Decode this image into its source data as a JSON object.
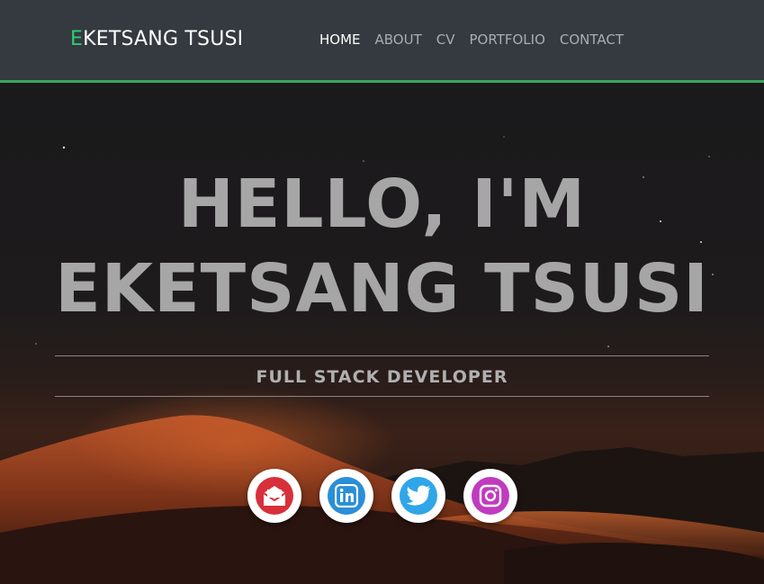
{
  "navbar": {
    "brand_first_letter": "E",
    "brand_rest": "KETSANG TSUSI",
    "links": [
      {
        "label": "HOME",
        "active": true
      },
      {
        "label": "ABOUT",
        "active": false
      },
      {
        "label": "CV",
        "active": false
      },
      {
        "label": "PORTFOLIO",
        "active": false
      },
      {
        "label": "CONTACT",
        "active": false
      }
    ]
  },
  "hero": {
    "headline_line1": "HELLO, I'M",
    "headline_line2": "EKETSANG TSUSI",
    "subtitle": "FULL STACK DEVELOPER"
  },
  "socials": [
    {
      "icon": "email-icon",
      "color": "#d8303a"
    },
    {
      "icon": "linkedin-icon",
      "color": "#2a8fd6"
    },
    {
      "icon": "twitter-icon",
      "color": "#2ea6e8"
    },
    {
      "icon": "instagram-icon",
      "color": "#c03bbf"
    }
  ],
  "colors": {
    "navbar_bg": "#343a40",
    "brand_accent": "#2ecc71",
    "navbar_border": "#3aa85a",
    "headline": "#a6a6a6"
  }
}
